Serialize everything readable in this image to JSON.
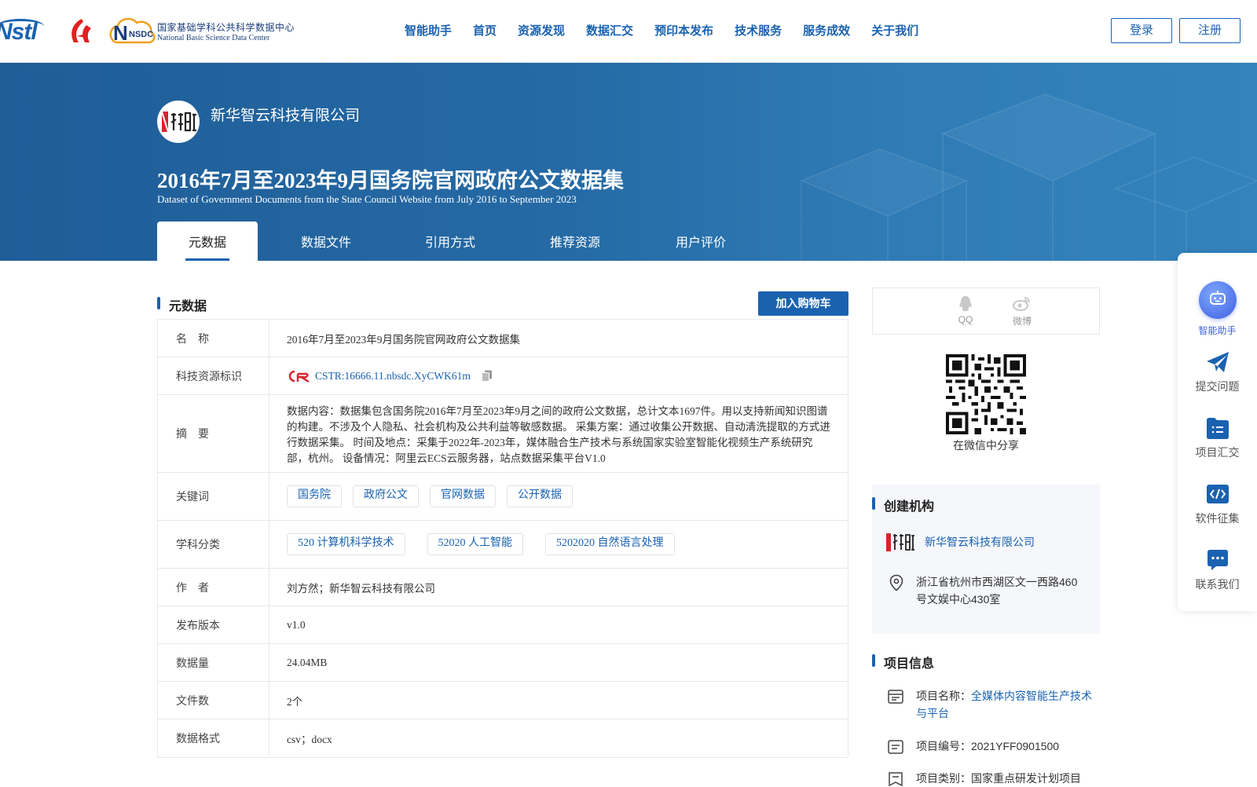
{
  "header": {
    "nav": [
      "智能助手",
      "首页",
      "资源发现",
      "数据汇交",
      "预印本发布",
      "技术服务",
      "服务成效",
      "关于我们"
    ],
    "login": "登录",
    "register": "注册",
    "logo_nstl_text": "Nstl",
    "logo_nsdc_mark": "NSDC",
    "logo_nsdc_cn": "国家基础学科公共科学数据中心",
    "logo_nsdc_en": "National Basic Science Data Center"
  },
  "banner": {
    "org_name": "新华智云科技有限公司",
    "title_cn": "2016年7月至2023年9月国务院官网政府公文数据集",
    "title_en": "Dataset of Government Documents from the State Council Website from July 2016 to September 2023",
    "tabs": [
      "元数据",
      "数据文件",
      "引用方式",
      "推荐资源",
      "用户评价"
    ]
  },
  "metadata": {
    "section_title": "元数据",
    "cart_button": "加入购物车",
    "rows": {
      "name": {
        "k": "名　称",
        "v": "2016年7月至2023年9月国务院官网政府公文数据集"
      },
      "cstr": {
        "k": "科技资源标识",
        "v": "CSTR:16666.11.nbsdc.XyCWK61m",
        "logo": "CSTR"
      },
      "abstract": {
        "k": "摘　要",
        "v": "数据内容：数据集包含国务院2016年7月至2023年9月之间的政府公文数据，总计文本1697件。用以支持新闻知识图谱的构建。不涉及个人隐私、社会机构及公共利益等敏感数据。 采集方案：通过收集公开数据、自动清洗提取的方式进行数据采集。 时间及地点：采集于2022年-2023年，媒体融合生产技术与系统国家实验室智能化视频生产系统研究部，杭州。 设备情况：阿里云ECS云服务器，站点数据采集平台V1.0"
      },
      "keywords": {
        "k": "关键词",
        "v": [
          "国务院",
          "政府公文",
          "官网数据",
          "公开数据"
        ]
      },
      "subjects": {
        "k": "学科分类",
        "v": [
          "520 计算机科学技术",
          "52020 人工智能",
          "5202020 自然语言处理"
        ]
      },
      "author": {
        "k": "作　者",
        "v": "刘方然；新华智云科技有限公司"
      },
      "version": {
        "k": "发布版本",
        "v": "v1.0"
      },
      "size": {
        "k": "数据量",
        "v": "24.04MB"
      },
      "files": {
        "k": "文件数",
        "v": "2个"
      },
      "format": {
        "k": "数据格式",
        "v": "csv；docx"
      }
    }
  },
  "share": {
    "qq": "QQ",
    "weibo": "微博",
    "wechat_caption": "在微信中分享"
  },
  "institution": {
    "section_title": "创建机构",
    "name": "新华智云科技有限公司",
    "address": "浙江省杭州市西湖区文一西路460号文娱中心430室"
  },
  "project": {
    "section_title": "项目信息",
    "name_label": "项目名称：",
    "name_value": "全媒体内容智能生产技术与平台",
    "code_label": "项目编号：",
    "code_value": "2021YFF0901500",
    "type_label": "项目类别：",
    "type_value": "国家重点研发计划项目"
  },
  "float_bar": [
    "智能助手",
    "提交问题",
    "项目汇交",
    "软件征集",
    "联系我们"
  ],
  "colors": {
    "accent": "#1a62b0",
    "banner": "#256aa5"
  }
}
